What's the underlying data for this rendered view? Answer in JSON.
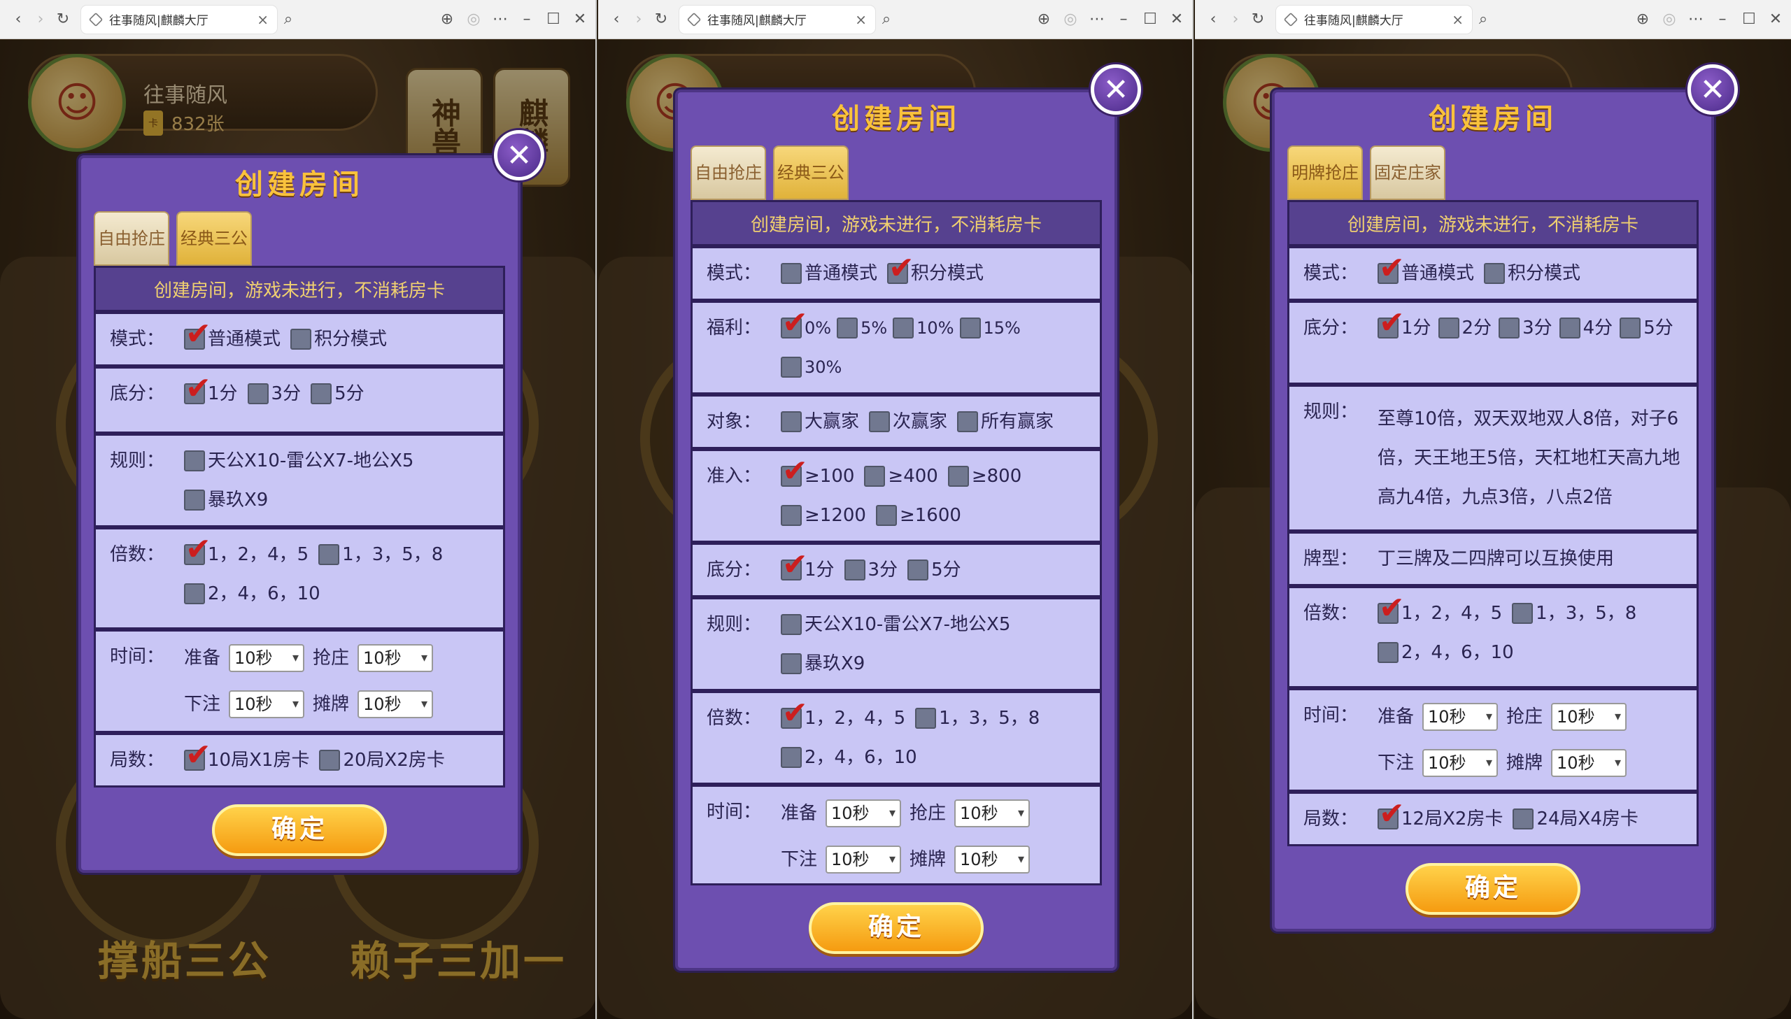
{
  "window_title": "往事随风|麒麟大厅",
  "player": {
    "name": "往事随风",
    "cards": "832张"
  },
  "side_badges": {
    "beast": "神兽",
    "qilin": "麒麟"
  },
  "bg_titles": {
    "chuanchuan": "撑船三公",
    "laizi": "赖子三加一"
  },
  "modal_title": "创建房间",
  "notice": "创建房间，游戏未进行，不消耗房卡",
  "confirm": "确定",
  "panels": [
    {
      "tabs": [
        "自由抢庄",
        "经典三公"
      ],
      "rows": [
        {
          "label": "模式：",
          "options": [
            {
              "text": "普通模式",
              "on": true
            },
            {
              "text": "积分模式",
              "on": false
            }
          ]
        },
        {
          "label": "底分：",
          "options": [
            {
              "text": "1分",
              "on": true
            },
            {
              "text": "3分",
              "on": false
            },
            {
              "text": "5分",
              "on": false
            }
          ]
        },
        {
          "label": "规则：",
          "options": [
            {
              "text": "天公X10-雷公X7-地公X5",
              "on": false
            },
            {
              "text": "暴玖X9",
              "on": false
            }
          ]
        },
        {
          "label": "倍数：",
          "options": [
            {
              "text": "1，2，4，5",
              "on": true
            },
            {
              "text": "1，3，5，8",
              "on": false
            },
            {
              "text": "2，4，6，10",
              "on": false
            }
          ]
        }
      ],
      "time": {
        "label": "时间：",
        "ready": "准备",
        "rob": "抢庄",
        "bet": "下注",
        "show": "摊牌",
        "value": "10秒"
      },
      "rounds": {
        "label": "局数：",
        "options": [
          {
            "text": "10局X1房卡",
            "on": true
          },
          {
            "text": "20局X2房卡",
            "on": false
          }
        ]
      }
    },
    {
      "tabs": [
        "自由抢庄",
        "经典三公"
      ],
      "rows": [
        {
          "label": "模式：",
          "options": [
            {
              "text": "普通模式",
              "on": false
            },
            {
              "text": "积分模式",
              "on": true
            }
          ]
        },
        {
          "label": "福利：",
          "options": [
            {
              "text": "0%",
              "on": true
            },
            {
              "text": "5%",
              "on": false
            },
            {
              "text": "10%",
              "on": false
            },
            {
              "text": "15%",
              "on": false
            },
            {
              "text": "30%",
              "on": false
            }
          ]
        },
        {
          "label": "对象：",
          "options": [
            {
              "text": "大赢家",
              "on": false
            },
            {
              "text": "次赢家",
              "on": false
            },
            {
              "text": "所有赢家",
              "on": false
            }
          ]
        },
        {
          "label": "准入：",
          "options": [
            {
              "text": "≥100",
              "on": true
            },
            {
              "text": "≥400",
              "on": false
            },
            {
              "text": "≥800",
              "on": false
            },
            {
              "text": "≥1200",
              "on": false
            },
            {
              "text": "≥1600",
              "on": false
            }
          ]
        },
        {
          "label": "底分：",
          "options": [
            {
              "text": "1分",
              "on": true
            },
            {
              "text": "3分",
              "on": false
            },
            {
              "text": "5分",
              "on": false
            }
          ]
        },
        {
          "label": "规则：",
          "options": [
            {
              "text": "天公X10-雷公X7-地公X5",
              "on": false
            },
            {
              "text": "暴玖X9",
              "on": false
            }
          ]
        },
        {
          "label": "倍数：",
          "options": [
            {
              "text": "1，2，4，5",
              "on": true
            },
            {
              "text": "1，3，5，8",
              "on": false
            },
            {
              "text": "2，4，6，10",
              "on": false
            }
          ]
        }
      ],
      "time": {
        "label": "时间：",
        "ready": "准备",
        "rob": "抢庄",
        "bet": "下注",
        "show": "摊牌",
        "value": "10秒"
      }
    },
    {
      "tabs": [
        "明牌抢庄",
        "固定庄家"
      ],
      "rows": [
        {
          "label": "模式：",
          "options": [
            {
              "text": "普通模式",
              "on": true
            },
            {
              "text": "积分模式",
              "on": false
            }
          ]
        },
        {
          "label": "底分：",
          "options": [
            {
              "text": "1分",
              "on": true
            },
            {
              "text": "2分",
              "on": false
            },
            {
              "text": "3分",
              "on": false
            },
            {
              "text": "4分",
              "on": false
            },
            {
              "text": "5分",
              "on": false
            }
          ]
        }
      ],
      "rule_text": {
        "label": "规则：",
        "text": "至尊10倍，双天双地双人8倍，对子6倍，天王地王5倍，天杠地杠天高九地高九4倍，九点3倍，八点2倍"
      },
      "card_type": {
        "label": "牌型：",
        "text": "丁三牌及二四牌可以互换使用"
      },
      "multiplier": {
        "label": "倍数：",
        "options": [
          {
            "text": "1，2，4，5",
            "on": true
          },
          {
            "text": "1，3，5，8",
            "on": false
          },
          {
            "text": "2，4，6，10",
            "on": false
          }
        ]
      },
      "time": {
        "label": "时间：",
        "ready": "准备",
        "rob": "抢庄",
        "bet": "下注",
        "show": "摊牌",
        "value": "10秒"
      },
      "rounds": {
        "label": "局数：",
        "options": [
          {
            "text": "12局X2房卡",
            "on": true
          },
          {
            "text": "24局X4房卡",
            "on": false
          }
        ]
      }
    }
  ]
}
